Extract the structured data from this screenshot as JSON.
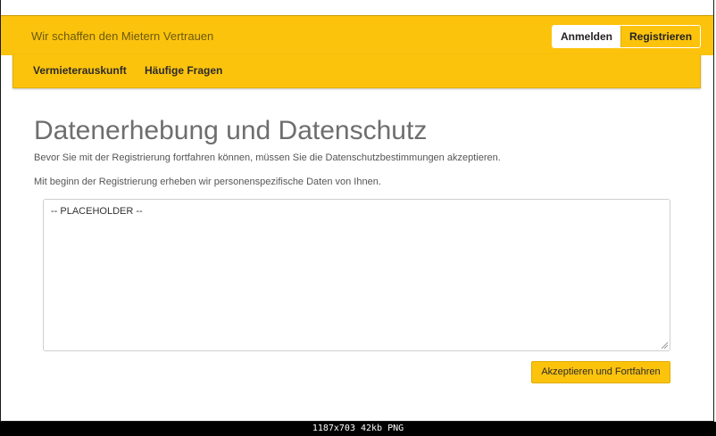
{
  "header": {
    "tagline": "Wir schaffen den Mietern Vertrauen",
    "login_label": "Anmelden",
    "register_label": "Registrieren"
  },
  "nav": {
    "items": [
      {
        "label": "Vermieterauskunft"
      },
      {
        "label": "Häufige Fragen"
      }
    ]
  },
  "main": {
    "title": "Datenerhebung und Datenschutz",
    "intro": "Bevor Sie mit der Registrierung fortfahren können, müssen Sie die Datenschutzbestimmungen akzeptieren.",
    "notice": "Mit beginn der Registrierung erheben wir personenspezifische Daten von Ihnen.",
    "textarea_value": "-- PLACEHOLDER --",
    "accept_label": "Akzeptieren und Fortfahren"
  },
  "image_info": "1187x703  42kb  PNG",
  "colors": {
    "brand_yellow": "#fcc30d",
    "title_gray": "#6e6e6e"
  }
}
